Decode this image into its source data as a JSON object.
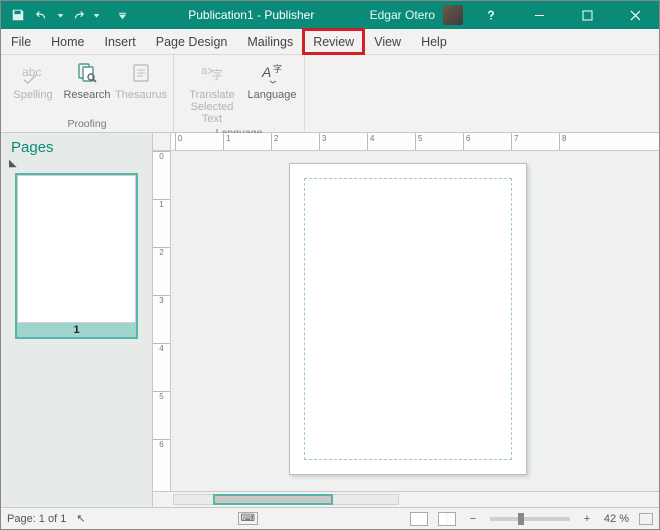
{
  "titlebar": {
    "doc_title": "Publication1",
    "app_name": "Publisher",
    "user_name": "Edgar Otero"
  },
  "tabs": [
    "File",
    "Home",
    "Insert",
    "Page Design",
    "Mailings",
    "Review",
    "View",
    "Help"
  ],
  "highlighted_tab": "Review",
  "ribbon": {
    "group_proofing": {
      "name": "Proofing",
      "spelling": "Spelling",
      "research": "Research",
      "thesaurus": "Thesaurus"
    },
    "group_language": {
      "name": "Language",
      "translate": "Translate\nSelected Text",
      "language": "Language"
    }
  },
  "pages_panel": {
    "header": "Pages",
    "thumb_number": "1"
  },
  "ruler_h": [
    "0",
    "1",
    "2",
    "3",
    "4",
    "5",
    "6",
    "7",
    "8"
  ],
  "ruler_v": [
    "0",
    "1",
    "2",
    "3",
    "4",
    "5",
    "6"
  ],
  "status": {
    "page_indicator": "Page: 1 of 1",
    "zoom_percent": "42 %"
  },
  "icons": {
    "save": "save-icon",
    "undo": "undo-icon",
    "redo": "redo-icon",
    "qat_more": "chevron-down-icon",
    "help": "help-icon",
    "minimize": "minimize-icon",
    "maximize": "maximize-icon",
    "close": "close-icon"
  },
  "colors": {
    "accent": "#0a8b7a",
    "highlight_box": "#d2202b"
  }
}
